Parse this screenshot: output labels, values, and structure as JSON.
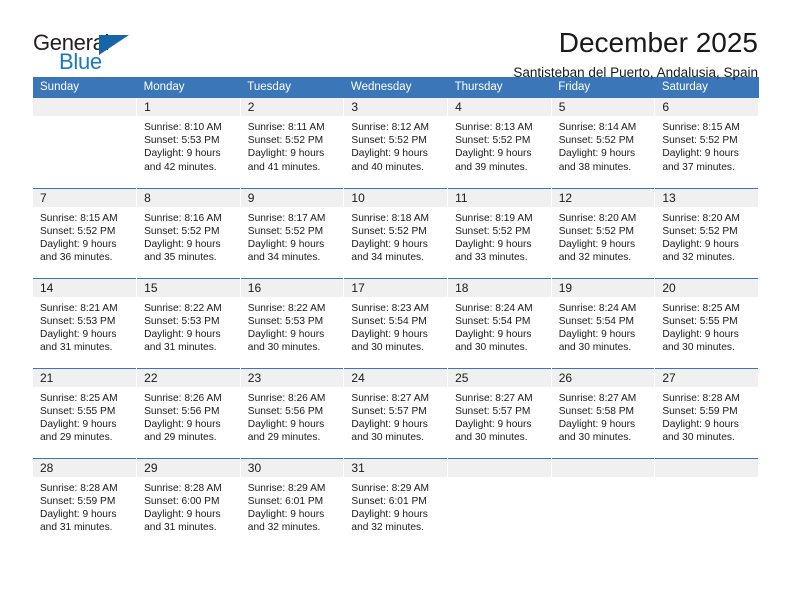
{
  "logo": {
    "primary_text": "General",
    "secondary_text": "Blue",
    "triangle_icon": "triangle-icon",
    "primary_color": "#231f20",
    "secondary_color": "#1c79c0",
    "triangle_color": "#1665a8"
  },
  "header": {
    "title": "December 2025",
    "subtitle": "Santisteban del Puerto, Andalusia, Spain"
  },
  "theme": {
    "header_bar_color": "#3a76b8",
    "daynum_band_color": "#f0f0f0",
    "text_color": "#1a1a1a"
  },
  "weekday_headers": [
    "Sunday",
    "Monday",
    "Tuesday",
    "Wednesday",
    "Thursday",
    "Friday",
    "Saturday"
  ],
  "weeks": [
    [
      {
        "day": "",
        "details": "",
        "empty": true
      },
      {
        "day": "1",
        "details": "Sunrise: 8:10 AM\nSunset: 5:53 PM\nDaylight: 9 hours\nand 42 minutes."
      },
      {
        "day": "2",
        "details": "Sunrise: 8:11 AM\nSunset: 5:52 PM\nDaylight: 9 hours\nand 41 minutes."
      },
      {
        "day": "3",
        "details": "Sunrise: 8:12 AM\nSunset: 5:52 PM\nDaylight: 9 hours\nand 40 minutes."
      },
      {
        "day": "4",
        "details": "Sunrise: 8:13 AM\nSunset: 5:52 PM\nDaylight: 9 hours\nand 39 minutes."
      },
      {
        "day": "5",
        "details": "Sunrise: 8:14 AM\nSunset: 5:52 PM\nDaylight: 9 hours\nand 38 minutes."
      },
      {
        "day": "6",
        "details": "Sunrise: 8:15 AM\nSunset: 5:52 PM\nDaylight: 9 hours\nand 37 minutes."
      }
    ],
    [
      {
        "day": "7",
        "details": "Sunrise: 8:15 AM\nSunset: 5:52 PM\nDaylight: 9 hours\nand 36 minutes."
      },
      {
        "day": "8",
        "details": "Sunrise: 8:16 AM\nSunset: 5:52 PM\nDaylight: 9 hours\nand 35 minutes."
      },
      {
        "day": "9",
        "details": "Sunrise: 8:17 AM\nSunset: 5:52 PM\nDaylight: 9 hours\nand 34 minutes."
      },
      {
        "day": "10",
        "details": "Sunrise: 8:18 AM\nSunset: 5:52 PM\nDaylight: 9 hours\nand 34 minutes."
      },
      {
        "day": "11",
        "details": "Sunrise: 8:19 AM\nSunset: 5:52 PM\nDaylight: 9 hours\nand 33 minutes."
      },
      {
        "day": "12",
        "details": "Sunrise: 8:20 AM\nSunset: 5:52 PM\nDaylight: 9 hours\nand 32 minutes."
      },
      {
        "day": "13",
        "details": "Sunrise: 8:20 AM\nSunset: 5:52 PM\nDaylight: 9 hours\nand 32 minutes."
      }
    ],
    [
      {
        "day": "14",
        "details": "Sunrise: 8:21 AM\nSunset: 5:53 PM\nDaylight: 9 hours\nand 31 minutes."
      },
      {
        "day": "15",
        "details": "Sunrise: 8:22 AM\nSunset: 5:53 PM\nDaylight: 9 hours\nand 31 minutes."
      },
      {
        "day": "16",
        "details": "Sunrise: 8:22 AM\nSunset: 5:53 PM\nDaylight: 9 hours\nand 30 minutes."
      },
      {
        "day": "17",
        "details": "Sunrise: 8:23 AM\nSunset: 5:54 PM\nDaylight: 9 hours\nand 30 minutes."
      },
      {
        "day": "18",
        "details": "Sunrise: 8:24 AM\nSunset: 5:54 PM\nDaylight: 9 hours\nand 30 minutes."
      },
      {
        "day": "19",
        "details": "Sunrise: 8:24 AM\nSunset: 5:54 PM\nDaylight: 9 hours\nand 30 minutes."
      },
      {
        "day": "20",
        "details": "Sunrise: 8:25 AM\nSunset: 5:55 PM\nDaylight: 9 hours\nand 30 minutes."
      }
    ],
    [
      {
        "day": "21",
        "details": "Sunrise: 8:25 AM\nSunset: 5:55 PM\nDaylight: 9 hours\nand 29 minutes."
      },
      {
        "day": "22",
        "details": "Sunrise: 8:26 AM\nSunset: 5:56 PM\nDaylight: 9 hours\nand 29 minutes."
      },
      {
        "day": "23",
        "details": "Sunrise: 8:26 AM\nSunset: 5:56 PM\nDaylight: 9 hours\nand 29 minutes."
      },
      {
        "day": "24",
        "details": "Sunrise: 8:27 AM\nSunset: 5:57 PM\nDaylight: 9 hours\nand 30 minutes."
      },
      {
        "day": "25",
        "details": "Sunrise: 8:27 AM\nSunset: 5:57 PM\nDaylight: 9 hours\nand 30 minutes."
      },
      {
        "day": "26",
        "details": "Sunrise: 8:27 AM\nSunset: 5:58 PM\nDaylight: 9 hours\nand 30 minutes."
      },
      {
        "day": "27",
        "details": "Sunrise: 8:28 AM\nSunset: 5:59 PM\nDaylight: 9 hours\nand 30 minutes."
      }
    ],
    [
      {
        "day": "28",
        "details": "Sunrise: 8:28 AM\nSunset: 5:59 PM\nDaylight: 9 hours\nand 31 minutes."
      },
      {
        "day": "29",
        "details": "Sunrise: 8:28 AM\nSunset: 6:00 PM\nDaylight: 9 hours\nand 31 minutes."
      },
      {
        "day": "30",
        "details": "Sunrise: 8:29 AM\nSunset: 6:01 PM\nDaylight: 9 hours\nand 32 minutes."
      },
      {
        "day": "31",
        "details": "Sunrise: 8:29 AM\nSunset: 6:01 PM\nDaylight: 9 hours\nand 32 minutes."
      },
      {
        "day": "",
        "details": "",
        "empty": true
      },
      {
        "day": "",
        "details": "",
        "empty": true
      },
      {
        "day": "",
        "details": "",
        "empty": true
      }
    ]
  ]
}
